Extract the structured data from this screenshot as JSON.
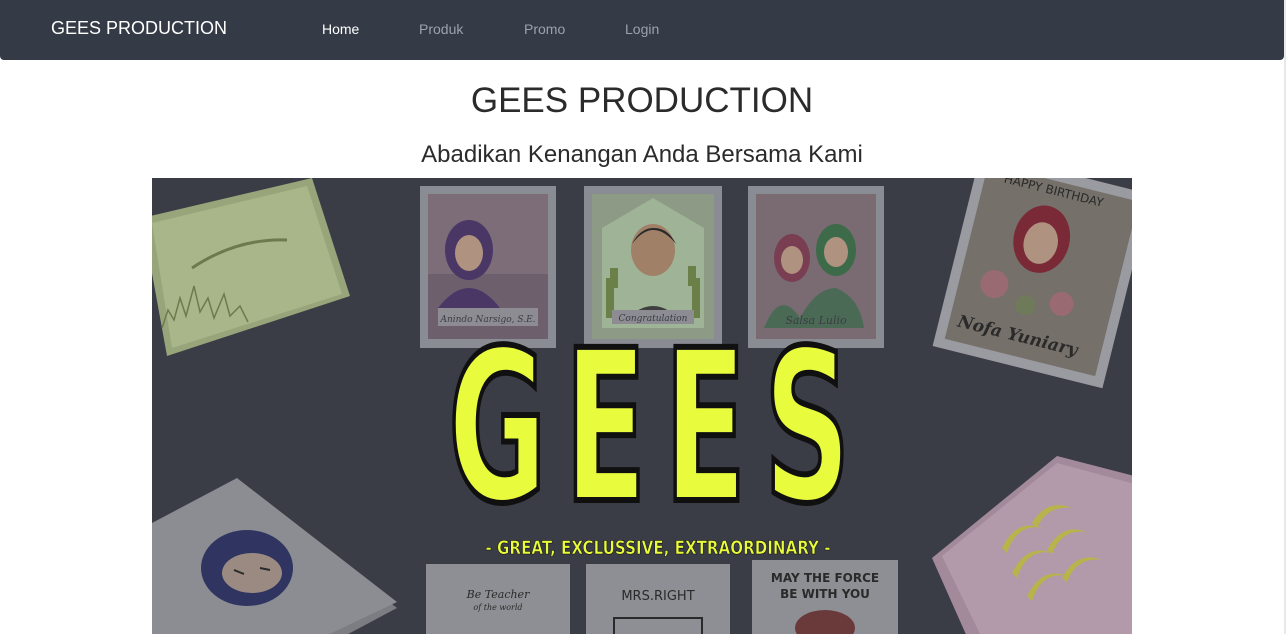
{
  "navbar": {
    "brand": "GEES PRODUCTION",
    "items": [
      {
        "label": "Home",
        "active": true
      },
      {
        "label": "Produk",
        "active": false
      },
      {
        "label": "Promo",
        "active": false
      },
      {
        "label": "Login",
        "active": false
      }
    ]
  },
  "header": {
    "title": "GEES PRODUCTION",
    "subtitle": "Abadikan Kenangan Anda Bersama Kami"
  },
  "hero": {
    "logo_text": "GEES",
    "tagline": "- GREAT, EXCLUSSIVE, EXTRAORDINARY -",
    "card_texts": {
      "happy_birthday": "HAPPY BIRTHDAY",
      "birthday_name": "Nofa Yuniary",
      "teacher": "Be Teacher",
      "teacher_sub": "of the world",
      "mrs_right": "MRS.RIGHT",
      "force_line1": "MAY THE FORCE",
      "force_line2": "BE WITH YOU",
      "congrats": "Congratulation",
      "congrats_name": "Anindo Narsigo, S.E.",
      "salsa": "Salsa Lulio"
    }
  },
  "colors": {
    "navbar_bg": "#343a46",
    "hero_bg": "#3a3c46",
    "logo_fill": "#e8fb3c",
    "active_link": "#ffffff",
    "inactive_link": "#9da2aa"
  }
}
